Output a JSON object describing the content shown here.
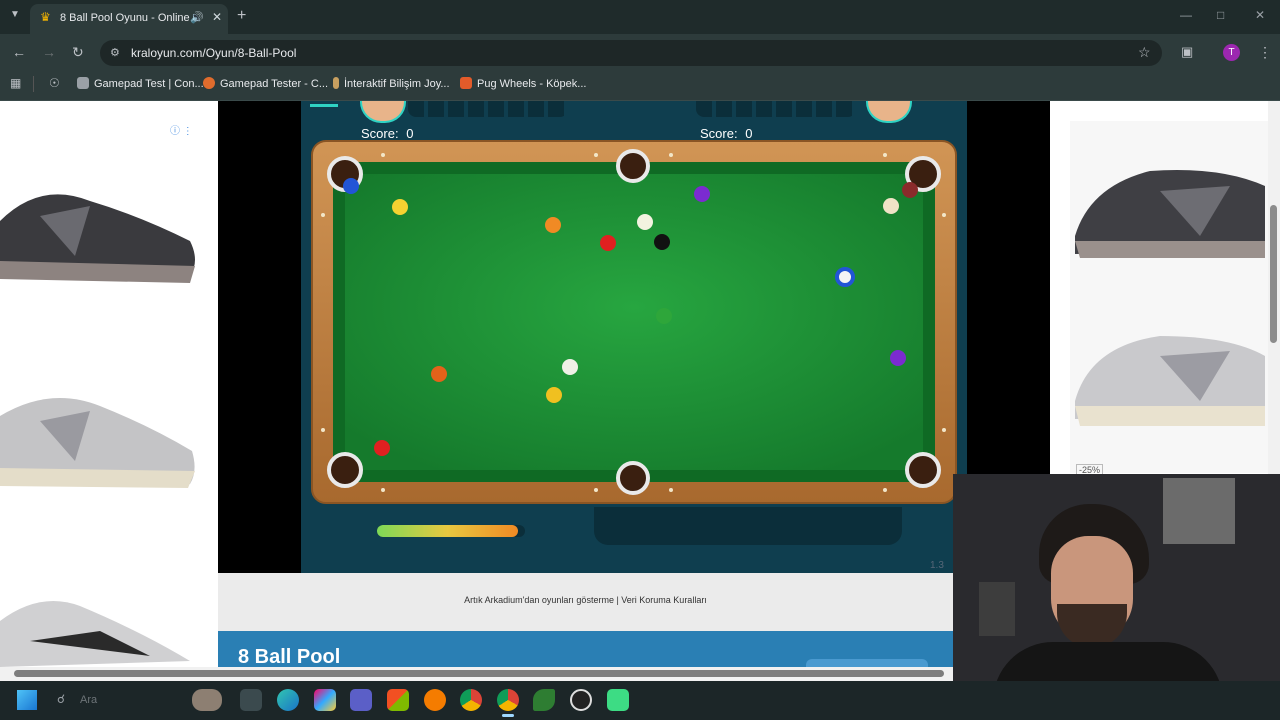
{
  "browser": {
    "tab_title": "8 Ball Pool Oyunu - Online",
    "url": "kraloyun.com/Oyun/8-Ball-Pool",
    "bookmarks": [
      {
        "label": "Gamepad Test | Con...",
        "color": "#9aa0a6"
      },
      {
        "label": "Gamepad Tester - C...",
        "color": "#e06c2d"
      },
      {
        "label": "İnteraktif Bilişim Joy...",
        "color": "#c8a060"
      },
      {
        "label": "Pug Wheels - Köpek...",
        "color": "#e35b2a"
      }
    ],
    "profile_initial": "T"
  },
  "game": {
    "player1_score_label": "Score:",
    "player1_score": "0",
    "player2_score_label": "Score:",
    "player2_score": "0",
    "version": "1.3",
    "power_level": 0.95
  },
  "page": {
    "footer_text": "Artık Arkadium'dan oyunları gösterme | Veri Koruma Kuralları",
    "game_title": "8 Ball Pool",
    "ad_discount": "-25%"
  },
  "taskbar": {
    "search_label": "Ara"
  },
  "colors": {
    "felt": "#1f9a3a",
    "wood": "#c8894a",
    "accent": "#2a7fb4"
  }
}
